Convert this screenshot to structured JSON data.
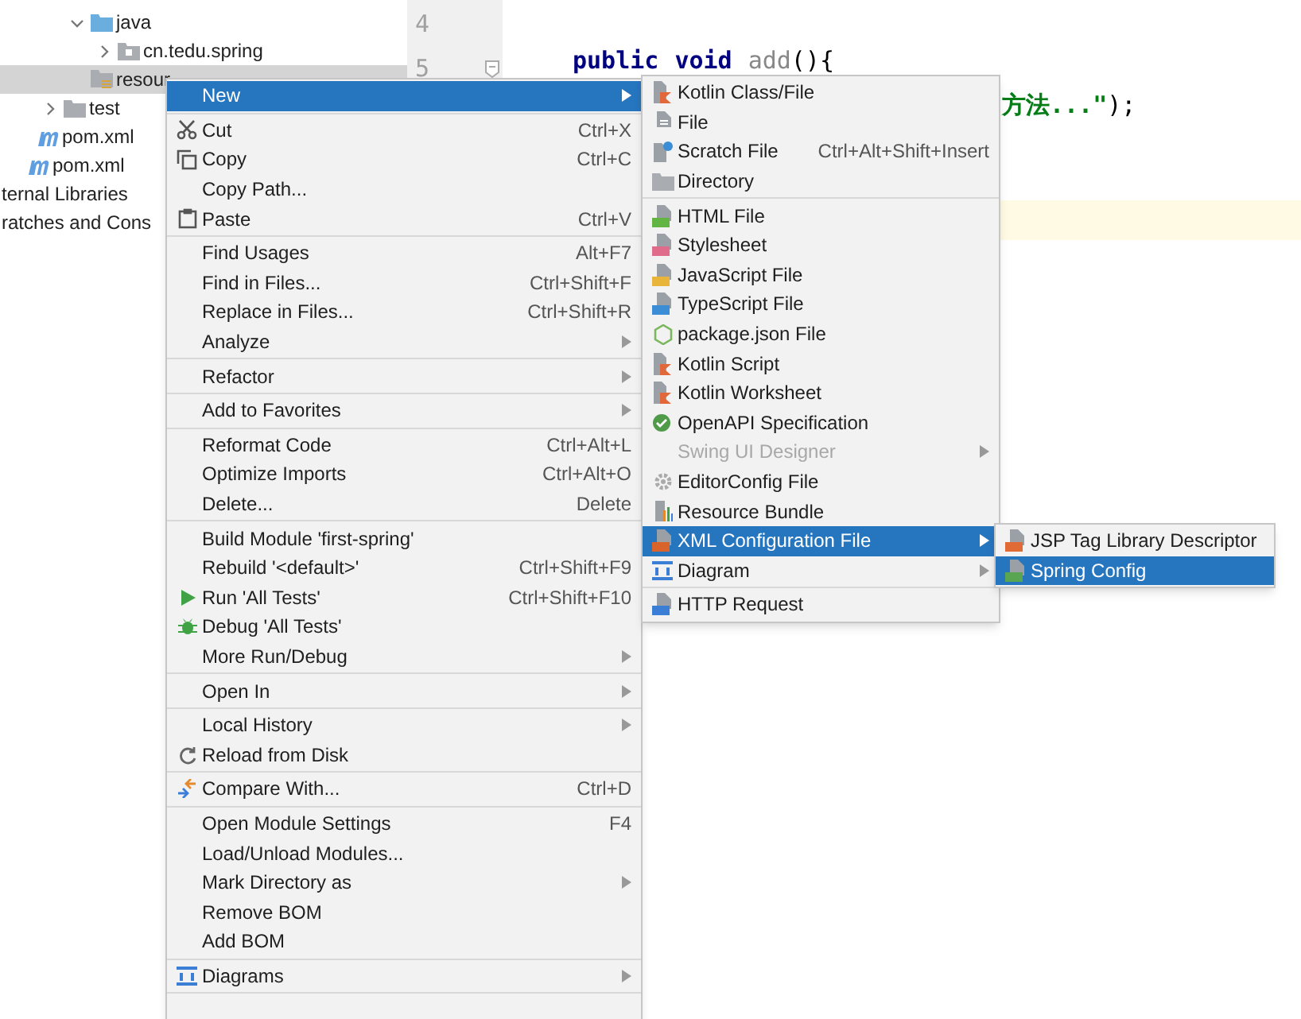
{
  "project_tree": [
    {
      "children": [
        {
          "children": [
            {
              "children": [
                {
                  "label": "java",
                  "kind": "source-folder",
                  "expanded": true,
                  "selected": false,
                  "children": [
                    {
                      "label": "cn.tedu.spring",
                      "kind": "package",
                      "expanded": false,
                      "selected": false
                    }
                  ]
                },
                {
                  "label": "resour",
                  "kind": "resources-folder",
                  "selected": true
                }
              ]
            },
            {
              "label": "test",
              "kind": "folder",
              "expanded": false,
              "selected": false
            }
          ]
        },
        {
          "label": "pom.xml",
          "kind": "maven",
          "selected": false
        }
      ]
    },
    {
      "label": "pom.xml",
      "kind": "maven",
      "selected": false
    },
    {
      "label": "ternal Libraries",
      "kind": "plain",
      "selected": false
    },
    {
      "label": "ratches and Cons",
      "kind": "plain",
      "selected": false
    }
  ],
  "gutter": {
    "line_numbers": [
      "4",
      "5"
    ]
  },
  "editor": {
    "lines": [
      {
        "tokens": [
          {
            "text": "public",
            "kind": "keyword"
          },
          {
            "text": "void",
            "kind": "keyword"
          },
          {
            "text": "add",
            "kind": "name"
          },
          {
            "text": "(){",
            "kind": "punct"
          }
        ]
      },
      {
        "tokens": [
          {
            "text": "方法...\"",
            "kind": "string"
          },
          {
            "text": ");",
            "kind": "punct"
          }
        ]
      }
    ]
  },
  "context_menu": {
    "items": [
      {
        "kind": "item",
        "label": "New",
        "has_submenu": true,
        "selected": true
      },
      {
        "kind": "separator"
      },
      {
        "kind": "item",
        "label": "Cut",
        "shortcut": "Ctrl+X",
        "has_submenu": false,
        "selected": false
      },
      {
        "kind": "item",
        "label": "Copy",
        "shortcut": "Ctrl+C",
        "has_submenu": false,
        "selected": false
      },
      {
        "kind": "item",
        "label": "Copy Path...",
        "has_submenu": false,
        "selected": false
      },
      {
        "kind": "item",
        "label": "Paste",
        "shortcut": "Ctrl+V",
        "has_submenu": false,
        "selected": false
      },
      {
        "kind": "separator"
      },
      {
        "kind": "item",
        "label": "Find Usages",
        "shortcut": "Alt+F7",
        "has_submenu": false,
        "selected": false
      },
      {
        "kind": "item",
        "label": "Find in Files...",
        "shortcut": "Ctrl+Shift+F",
        "has_submenu": false,
        "selected": false
      },
      {
        "kind": "item",
        "label": "Replace in Files...",
        "shortcut": "Ctrl+Shift+R",
        "has_submenu": false,
        "selected": false
      },
      {
        "kind": "item",
        "label": "Analyze",
        "has_submenu": true,
        "selected": false
      },
      {
        "kind": "separator"
      },
      {
        "kind": "item",
        "label": "Refactor",
        "has_submenu": true,
        "selected": false
      },
      {
        "kind": "separator"
      },
      {
        "kind": "item",
        "label": "Add to Favorites",
        "has_submenu": true,
        "selected": false
      },
      {
        "kind": "separator"
      },
      {
        "kind": "item",
        "label": "Reformat Code",
        "shortcut": "Ctrl+Alt+L",
        "has_submenu": false,
        "selected": false
      },
      {
        "kind": "item",
        "label": "Optimize Imports",
        "shortcut": "Ctrl+Alt+O",
        "has_submenu": false,
        "selected": false
      },
      {
        "kind": "item",
        "label": "Delete...",
        "shortcut": "Delete",
        "has_submenu": false,
        "selected": false
      },
      {
        "kind": "separator"
      },
      {
        "kind": "item",
        "label": "Build Module 'first-spring'",
        "has_submenu": false,
        "selected": false
      },
      {
        "kind": "item",
        "label": "Rebuild '<default>'",
        "shortcut": "Ctrl+Shift+F9",
        "has_submenu": false,
        "selected": false
      },
      {
        "kind": "item",
        "label": "Run 'All Tests'",
        "shortcut": "Ctrl+Shift+F10",
        "has_submenu": false,
        "selected": false
      },
      {
        "kind": "item",
        "label": "Debug 'All Tests'",
        "has_submenu": false,
        "selected": false
      },
      {
        "kind": "item",
        "label": "More Run/Debug",
        "has_submenu": true,
        "selected": false
      },
      {
        "kind": "separator"
      },
      {
        "kind": "item",
        "label": "Open In",
        "has_submenu": true,
        "selected": false
      },
      {
        "kind": "separator"
      },
      {
        "kind": "item",
        "label": "Local History",
        "has_submenu": true,
        "selected": false
      },
      {
        "kind": "item",
        "label": "Reload from Disk",
        "has_submenu": false,
        "selected": false
      },
      {
        "kind": "separator"
      },
      {
        "kind": "item",
        "label": "Compare With...",
        "shortcut": "Ctrl+D",
        "has_submenu": false,
        "selected": false
      },
      {
        "kind": "separator"
      },
      {
        "kind": "item",
        "label": "Open Module Settings",
        "shortcut": "F4",
        "has_submenu": false,
        "selected": false
      },
      {
        "kind": "item",
        "label": "Load/Unload Modules...",
        "has_submenu": false,
        "selected": false
      },
      {
        "kind": "item",
        "label": "Mark Directory as",
        "has_submenu": true,
        "selected": false
      },
      {
        "kind": "item",
        "label": "Remove BOM",
        "has_submenu": false,
        "selected": false
      },
      {
        "kind": "item",
        "label": "Add BOM",
        "has_submenu": false,
        "selected": false
      },
      {
        "kind": "separator"
      },
      {
        "kind": "item",
        "label": "Diagrams",
        "has_submenu": true,
        "selected": false
      },
      {
        "kind": "separator"
      }
    ]
  },
  "new_submenu": {
    "items": [
      {
        "kind": "item",
        "label": "Kotlin Class/File",
        "has_submenu": false,
        "selected": false,
        "disabled": false
      },
      {
        "kind": "item",
        "label": "File",
        "has_submenu": false,
        "selected": false,
        "disabled": false
      },
      {
        "kind": "item",
        "label": "Scratch File",
        "shortcut": "Ctrl+Alt+Shift+Insert",
        "has_submenu": false,
        "selected": false,
        "disabled": false
      },
      {
        "kind": "item",
        "label": "Directory",
        "has_submenu": false,
        "selected": false,
        "disabled": false
      },
      {
        "kind": "separator"
      },
      {
        "kind": "item",
        "label": "HTML File",
        "has_submenu": false,
        "selected": false,
        "disabled": false
      },
      {
        "kind": "item",
        "label": "Stylesheet",
        "has_submenu": false,
        "selected": false,
        "disabled": false
      },
      {
        "kind": "item",
        "label": "JavaScript File",
        "has_submenu": false,
        "selected": false,
        "disabled": false
      },
      {
        "kind": "item",
        "label": "TypeScript File",
        "has_submenu": false,
        "selected": false,
        "disabled": false
      },
      {
        "kind": "item",
        "label": "package.json File",
        "has_submenu": false,
        "selected": false,
        "disabled": false
      },
      {
        "kind": "item",
        "label": "Kotlin Script",
        "has_submenu": false,
        "selected": false,
        "disabled": false
      },
      {
        "kind": "item",
        "label": "Kotlin Worksheet",
        "has_submenu": false,
        "selected": false,
        "disabled": false
      },
      {
        "kind": "item",
        "label": "OpenAPI Specification",
        "has_submenu": false,
        "selected": false,
        "disabled": false
      },
      {
        "kind": "item",
        "label": "Swing UI Designer",
        "has_submenu": true,
        "selected": false,
        "disabled": true
      },
      {
        "kind": "item",
        "label": "EditorConfig File",
        "has_submenu": false,
        "selected": false,
        "disabled": false
      },
      {
        "kind": "item",
        "label": "Resource Bundle",
        "has_submenu": false,
        "selected": false,
        "disabled": false
      },
      {
        "kind": "item",
        "label": "XML Configuration File",
        "has_submenu": true,
        "selected": true,
        "disabled": false
      },
      {
        "kind": "item",
        "label": "Diagram",
        "has_submenu": true,
        "selected": false,
        "disabled": false
      },
      {
        "kind": "separator"
      },
      {
        "kind": "item",
        "label": "HTTP Request",
        "has_submenu": false,
        "selected": false,
        "disabled": false
      }
    ]
  },
  "xml_submenu": {
    "items": [
      {
        "kind": "item",
        "label": "JSP Tag Library Descriptor",
        "has_submenu": false,
        "selected": false
      },
      {
        "kind": "item",
        "label": "Spring Config",
        "has_submenu": false,
        "selected": true
      }
    ]
  }
}
